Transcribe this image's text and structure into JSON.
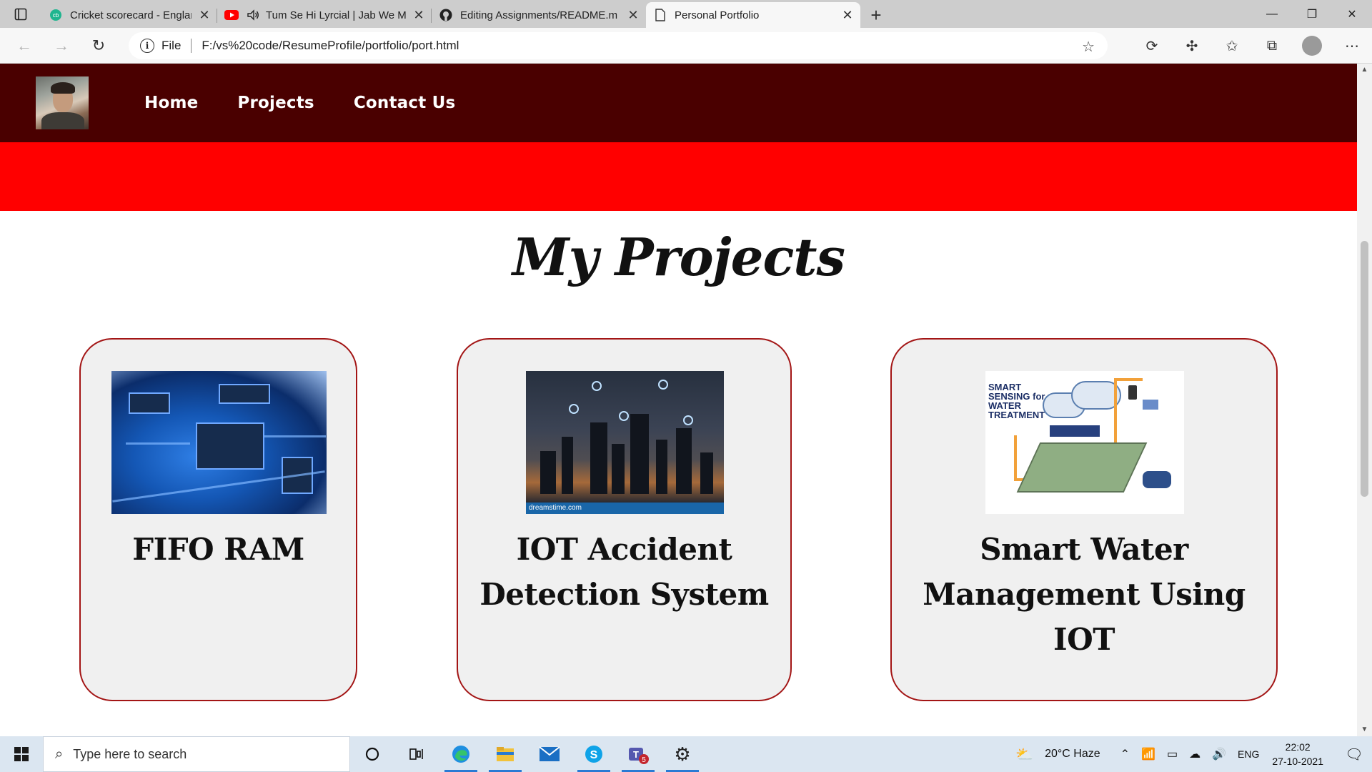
{
  "browser": {
    "tabs": [
      {
        "title": "Cricket scorecard - England vs Ba",
        "favicon": "cricbuzz-icon",
        "active": false
      },
      {
        "title": "Tum Se Hi Lyrcial | Jab We M",
        "favicon": "youtube-icon",
        "active": false
      },
      {
        "title": "Editing Assignments/README.m",
        "favicon": "github-icon",
        "active": false
      },
      {
        "title": "Personal Portfolio",
        "favicon": "page-icon",
        "active": true
      }
    ],
    "address": {
      "scheme": "File",
      "url": "F:/vs%20code/ResumeProfile/portfolio/port.html"
    }
  },
  "site": {
    "nav": {
      "links": [
        "Home",
        "Projects",
        "Contact Us"
      ]
    },
    "section_title": "My Projects",
    "projects": [
      {
        "title": "FIFO RAM",
        "image": "circuit-board-image"
      },
      {
        "title": "IOT Accident Detection System",
        "image": "smart-city-iot-image",
        "image_caption": "dreamstime.com"
      },
      {
        "title": "Smart Water Management Using IOT",
        "image": "water-treatment-diagram-image",
        "image_caption": "SMART SENSING for WATER TREATMENT"
      }
    ],
    "colors": {
      "nav_bg": "#4a0000",
      "band": "#ff0000",
      "card_border": "#a31515",
      "card_bg": "#f0f0f0"
    }
  },
  "taskbar": {
    "search_placeholder": "Type here to search",
    "weather": "20°C  Haze",
    "language": "ENG",
    "time": "22:02",
    "date": "27-10-2021",
    "teams_badge": "5"
  }
}
